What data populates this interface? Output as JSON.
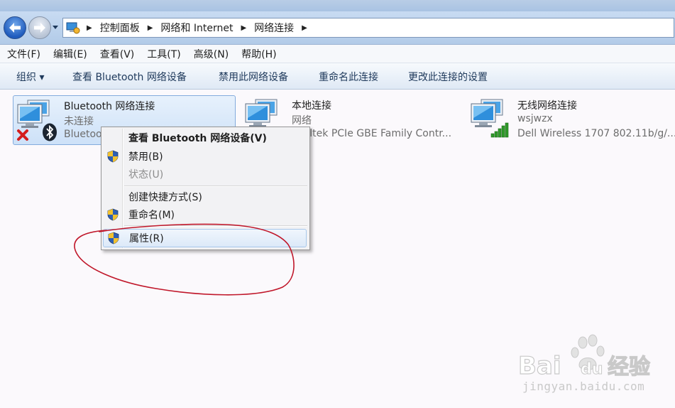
{
  "address_bar": {
    "breadcrumbs": [
      "控制面板",
      "网络和 Internet",
      "网络连接"
    ]
  },
  "menu": {
    "items": [
      "文件(F)",
      "编辑(E)",
      "查看(V)",
      "工具(T)",
      "高级(N)",
      "帮助(H)"
    ]
  },
  "toolbar": {
    "organize_label": "组织 ▾",
    "view_bt_label": "查看 Bluetooth 网络设备",
    "disable_label": "禁用此网络设备",
    "rename_label": "重命名此连接",
    "change_settings_label": "更改此连接的设置"
  },
  "connections": [
    {
      "name": "Bluetooth 网络连接",
      "status": "未连接",
      "device": "Bluetooth",
      "state": "disconnected"
    },
    {
      "name": "本地连接",
      "status": "网络",
      "device": "Realtek PCIe GBE Family Contr...",
      "state": "connected"
    },
    {
      "name": "无线网络连接",
      "status": "wsjwzx",
      "device": "Dell Wireless 1707 802.11b/g/...",
      "state": "connected"
    }
  ],
  "context_menu": {
    "items": [
      {
        "label": "查看 Bluetooth 网络设备(V)",
        "bold": true,
        "shield": false,
        "enabled": true
      },
      {
        "label": "禁用(B)",
        "bold": false,
        "shield": true,
        "enabled": true
      },
      {
        "label": "状态(U)",
        "bold": false,
        "shield": false,
        "enabled": false
      },
      {
        "label": "创建快捷方式(S)",
        "bold": false,
        "shield": false,
        "enabled": true
      },
      {
        "label": "重命名(M)",
        "bold": false,
        "shield": true,
        "enabled": true
      },
      {
        "label": "属性(R)",
        "bold": false,
        "shield": true,
        "enabled": true,
        "highlighted": true
      }
    ]
  },
  "watermark": {
    "brand": "Baidu经验",
    "domain": "jingyan.baidu.com"
  },
  "colors": {
    "annotation_red": "#c0172a",
    "selection_blue": "#cde1f8",
    "toolbar_text": "#1e395b",
    "signal_green": "#2f9a2a"
  }
}
